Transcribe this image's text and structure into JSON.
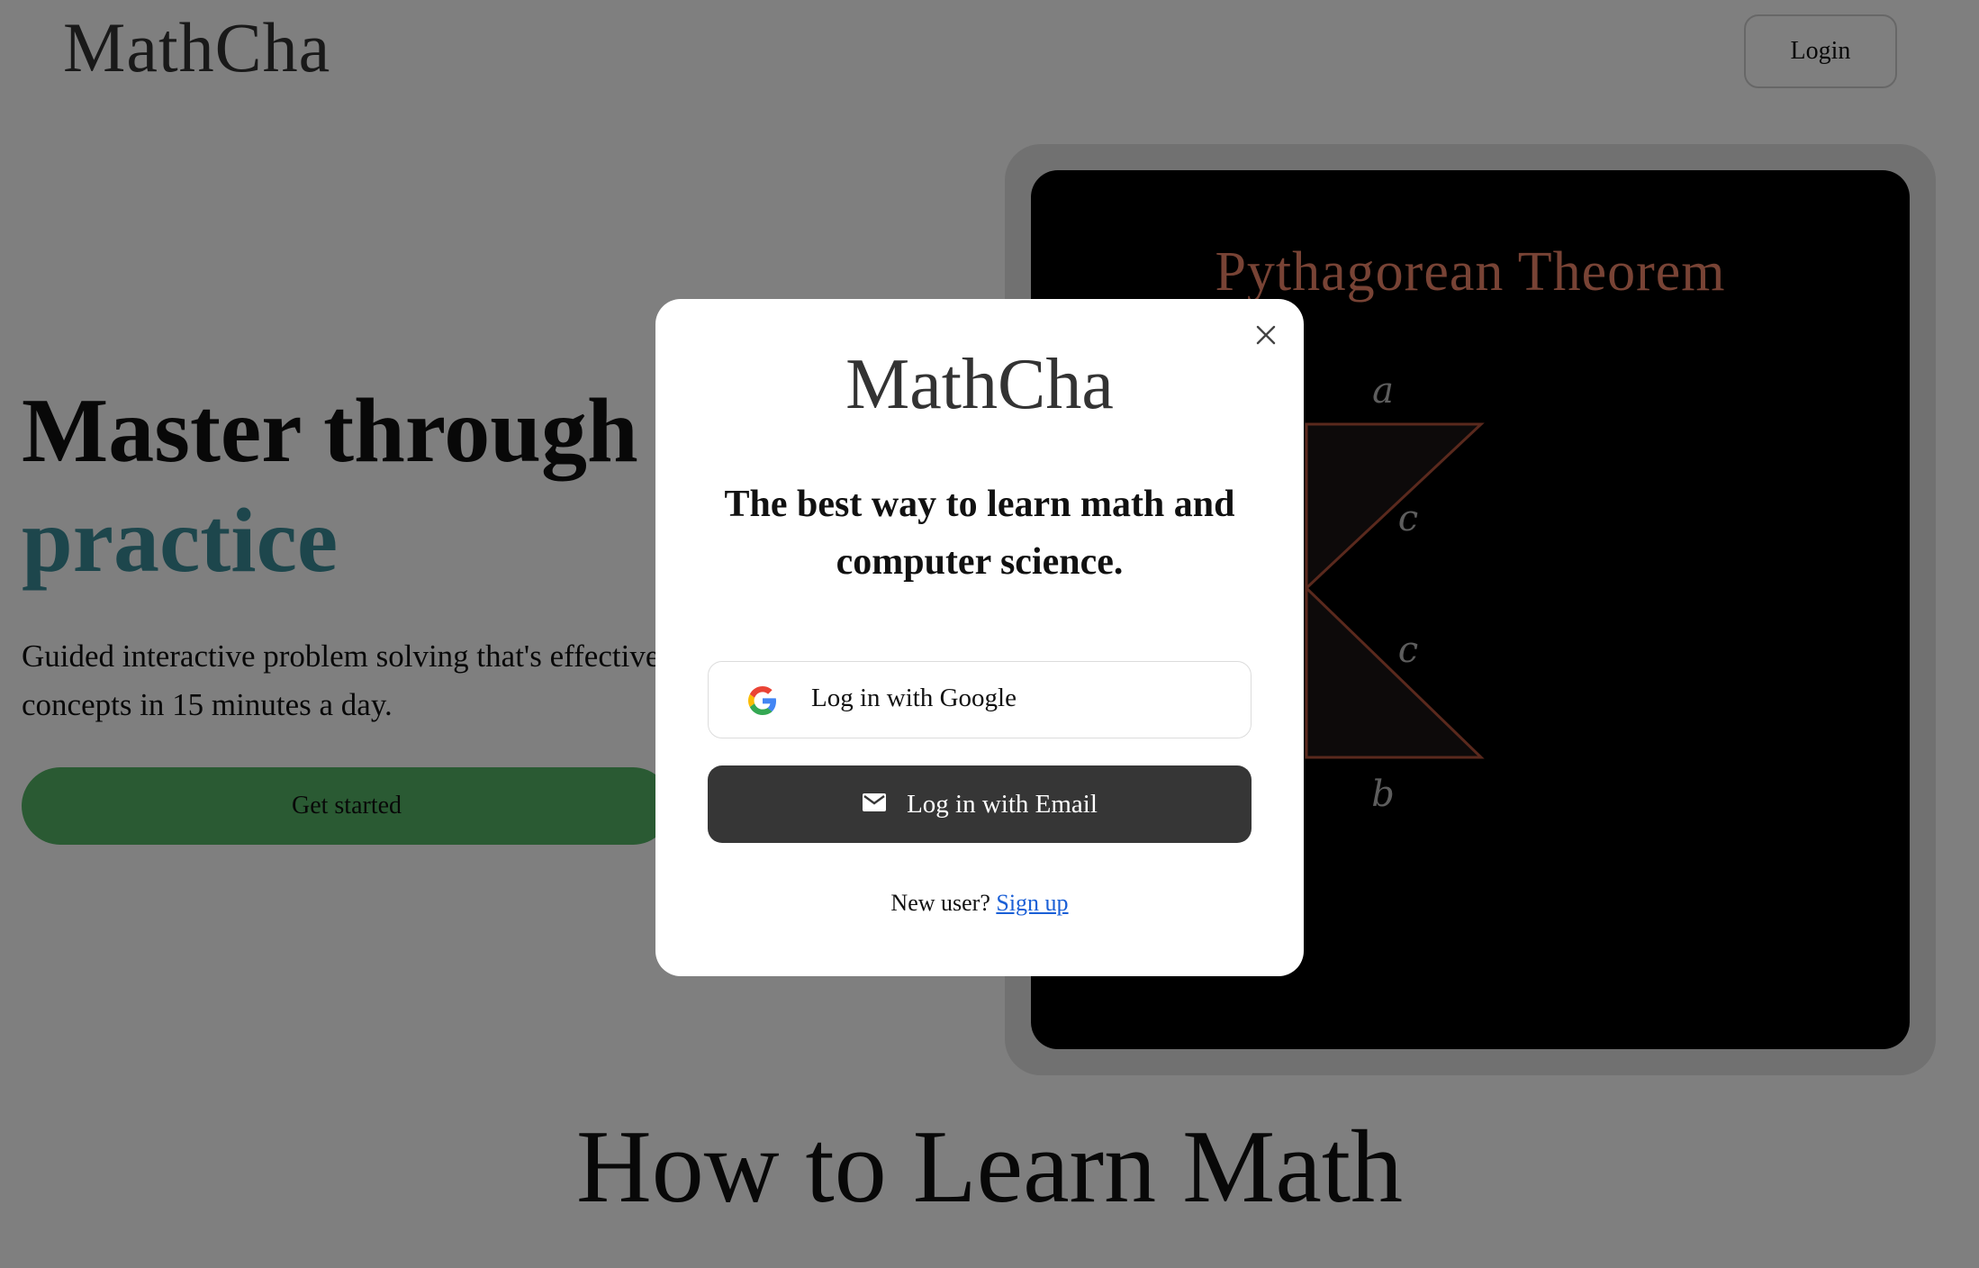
{
  "header": {
    "brand": "MathCha",
    "login_label": "Login"
  },
  "hero": {
    "title_line1": "Master through",
    "title_line2": "practice",
    "subtitle_line1": "Guided interactive problem solving that's effective and fun. Master",
    "subtitle_line2": "concepts in 15 minutes a day.",
    "cta_label": "Get started"
  },
  "demo": {
    "title": "Pythagorean Theorem",
    "labels": {
      "a": "a",
      "b": "b",
      "c1": "c",
      "c2": "c"
    }
  },
  "section": {
    "title": "How to Learn Math"
  },
  "modal": {
    "brand": "MathCha",
    "tagline": "The best way to learn math and computer science.",
    "google_label": "Log in with Google",
    "email_label": "Log in with Email",
    "new_user_text": "New user?",
    "signup_label": "Sign up",
    "close_icon": "close-icon",
    "google_icon": "google-icon",
    "email_icon": "mail-icon"
  },
  "colors": {
    "accent_teal": "#3a8d99",
    "cta_green": "#54b566",
    "email_button": "#363636",
    "link_blue": "#1a5fd6",
    "demo_title": "#f0876a",
    "triangle_stroke": "#b5523b"
  }
}
